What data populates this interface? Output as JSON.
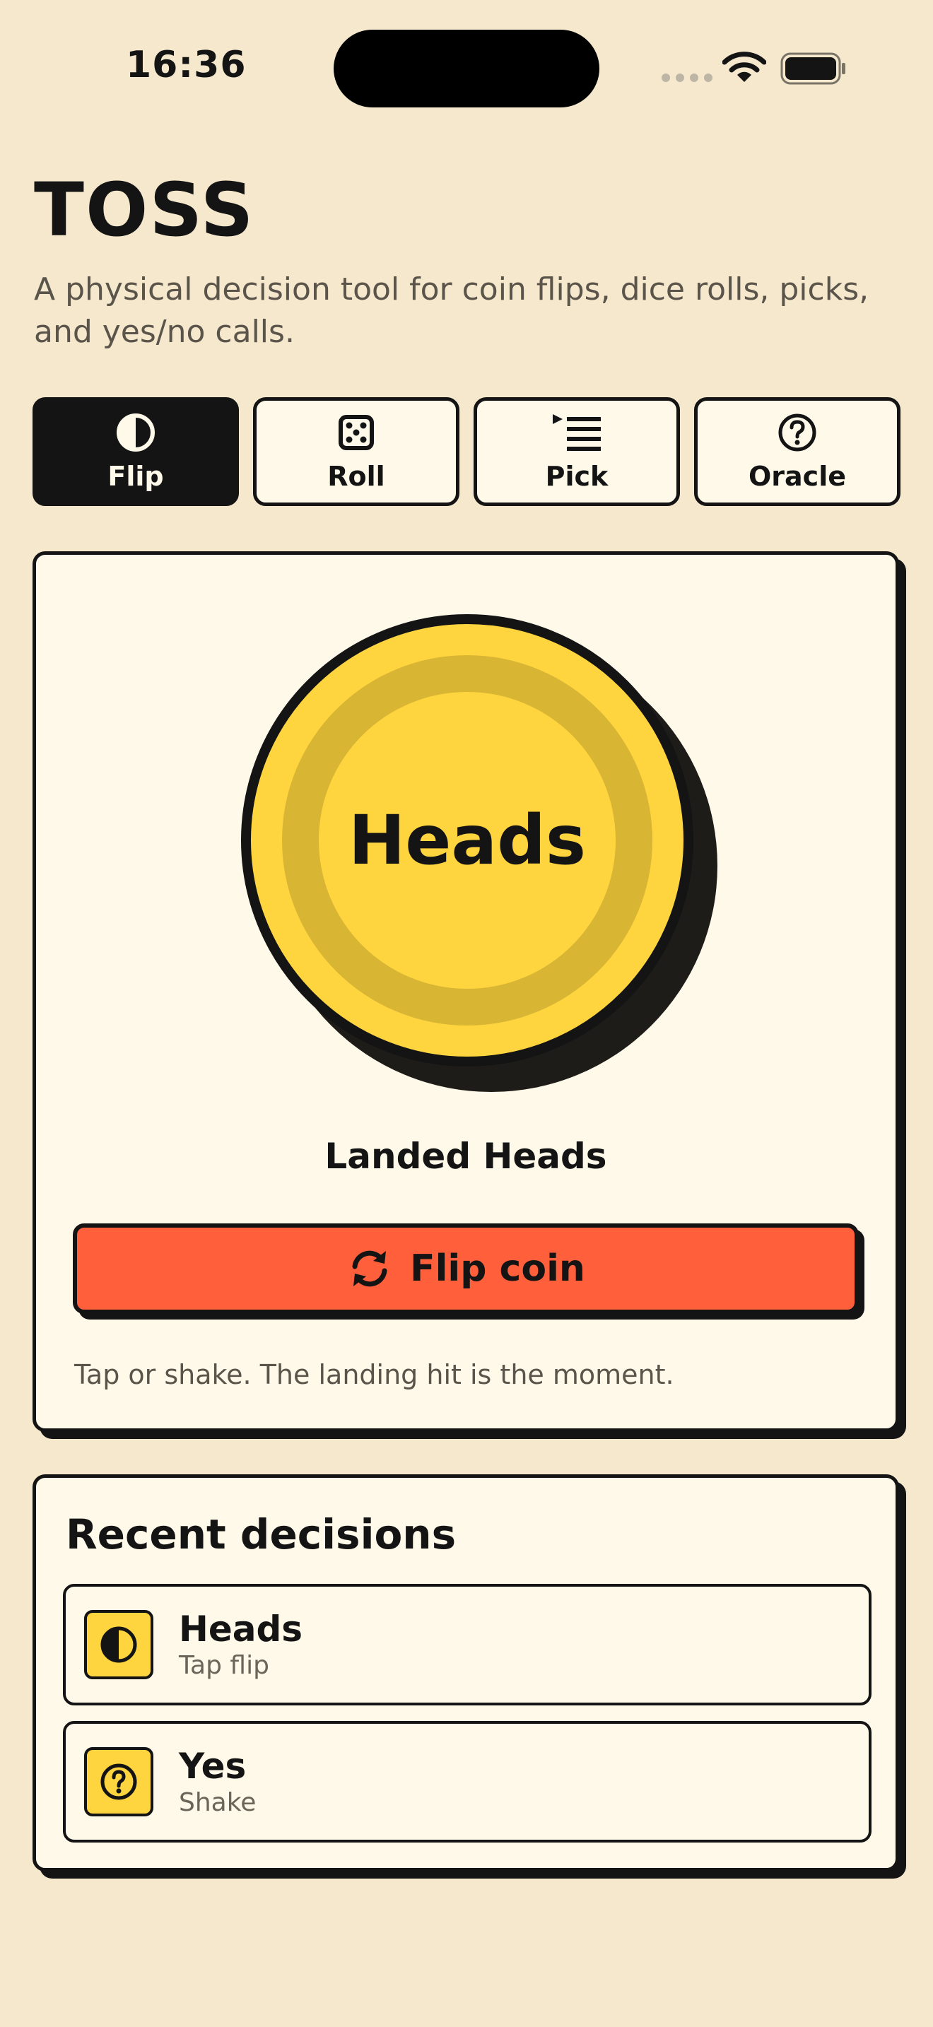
{
  "status_bar": {
    "time": "16:36"
  },
  "header": {
    "title": "TOSS",
    "subtitle": "A physical decision tool for coin flips, dice rolls, picks, and yes/no calls."
  },
  "tabs": [
    {
      "label": "Flip",
      "icon": "half-circle-icon",
      "active": true
    },
    {
      "label": "Roll",
      "icon": "dice-icon",
      "active": false
    },
    {
      "label": "Pick",
      "icon": "list-icon",
      "active": false
    },
    {
      "label": "Oracle",
      "icon": "question-circle-icon",
      "active": false
    }
  ],
  "flip": {
    "coin_face": "Heads",
    "result": "Landed Heads",
    "button_label": "Flip coin",
    "hint": "Tap or shake. The landing hit is the moment."
  },
  "recent": {
    "title": "Recent decisions",
    "items": [
      {
        "label": "Heads",
        "sub": "Tap flip",
        "icon": "half-circle-icon"
      },
      {
        "label": "Yes",
        "sub": "Shake",
        "icon": "question-circle-icon"
      }
    ]
  },
  "colors": {
    "background": "#F5E8CD",
    "card": "#FFF9E9",
    "ink": "#141414",
    "coin": "#FED43F",
    "accent": "#FF5F3A"
  }
}
